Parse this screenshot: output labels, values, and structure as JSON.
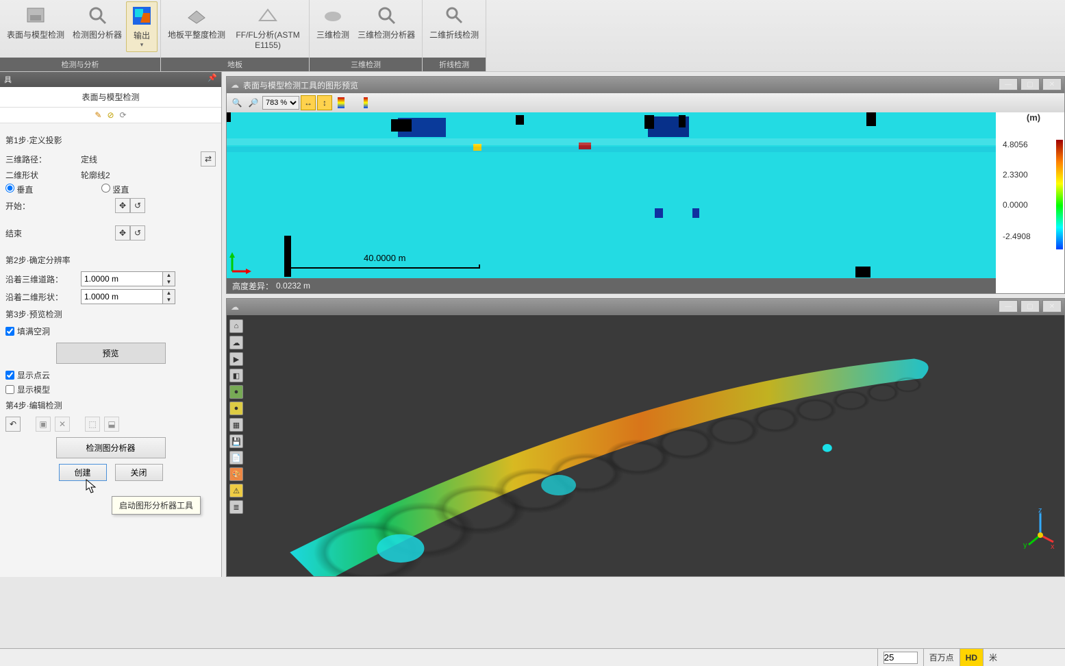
{
  "ribbon": {
    "groups": [
      {
        "label": "检测与分析",
        "items": [
          {
            "id": "surface-model",
            "label": "表面与模型检测"
          },
          {
            "id": "inspect-analyzer",
            "label": "检测图分析器"
          },
          {
            "id": "export",
            "label": "输出",
            "active": true
          }
        ]
      },
      {
        "label": "地板",
        "items": [
          {
            "id": "floor-flat",
            "label": "地板平整度检测"
          },
          {
            "id": "ffl",
            "label": "FF/FL分析(ASTM E1155)"
          }
        ]
      },
      {
        "label": "三维检测",
        "items": [
          {
            "id": "3d-detect",
            "label": "三维检测"
          },
          {
            "id": "3d-analyzer",
            "label": "三维检测分析器"
          }
        ]
      },
      {
        "label": "折线检测",
        "items": [
          {
            "id": "2d-poly",
            "label": "二维折线检测"
          }
        ]
      }
    ]
  },
  "sidepanel": {
    "tab": "具",
    "title": "表面与模型检测",
    "step1": "第1步·定义投影",
    "path3d_label": "三维路径：",
    "path3d_value": "定线",
    "shape2d_label": "二维形状",
    "shape2d_value": "轮廓线2",
    "orient_v": "垂直",
    "orient_h": "竖直",
    "start_label": "开始：",
    "end_label": "结束",
    "step2": "第2步·确定分辨率",
    "along3d_label": "沿着三维道路：",
    "along3d_value": "1.0000 m",
    "along2d_label": "沿着二维形状：",
    "along2d_value": "1.0000 m",
    "step3": "第3步·预览检测",
    "fill_holes": "填满空洞",
    "preview_btn": "预览",
    "show_pc": "显示点云",
    "show_model": "显示模型",
    "step4": "第4步·编辑检测",
    "analyzer_btn": "检测图分析器",
    "create_btn": "创建",
    "close_btn": "关闭",
    "tooltip": "启动图形分析器工具"
  },
  "topview": {
    "title": "表面与模型检测工具的图形预览",
    "zoom": "783 %",
    "scale": "40.0000 m",
    "status_label": "高度差异：",
    "status_value": "0.0232 m",
    "legend": {
      "unit": "(m)",
      "max": "4.8056",
      "mid1": "2.3300",
      "zero": "0.0000",
      "min": "-2.4908"
    }
  },
  "statusbar": {
    "points": "25",
    "unit_pts": "百万点",
    "hd": "HD",
    "unit_len": "米"
  }
}
